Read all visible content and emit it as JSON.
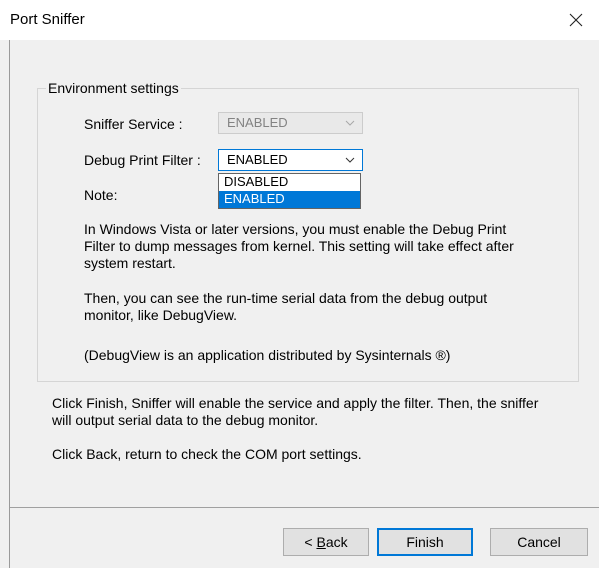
{
  "window": {
    "title": "Port Sniffer"
  },
  "group": {
    "title": "Environment settings"
  },
  "sniffer_service": {
    "label": "Sniffer Service :",
    "value": "ENABLED"
  },
  "debug_filter": {
    "label": "Debug Print Filter :",
    "value": "ENABLED",
    "options": [
      "DISABLED",
      "ENABLED"
    ]
  },
  "note": {
    "label": "Note:",
    "p1_line1": "In Windows Vista or later versions, you must enable the Debug Print",
    "p1_line2": "Filter to dump messages from kernel. This setting will take effect after",
    "p1_line3": "system restart.",
    "p2_line1": "Then, you can see the run-time serial data from the debug output",
    "p2_line2": "monitor, like DebugView.",
    "p3": "(DebugView is an application distributed by Sysinternals ®)"
  },
  "instructions": {
    "finish_line1": "Click Finish, Sniffer will enable the service and apply the filter. Then, the sniffer",
    "finish_line2": "will output serial data to the debug monitor.",
    "back": "Click Back, return to check the COM port settings."
  },
  "buttons": {
    "back_prefix": "< ",
    "back_accel": "B",
    "back_rest": "ack",
    "finish": "Finish",
    "cancel": "Cancel"
  },
  "icons": {
    "close": "close-icon",
    "dropdown": "chevron-down-icon"
  },
  "colors": {
    "accent": "#0078d7",
    "window_bg": "#f0f0f0",
    "disabled_text": "#838383"
  }
}
